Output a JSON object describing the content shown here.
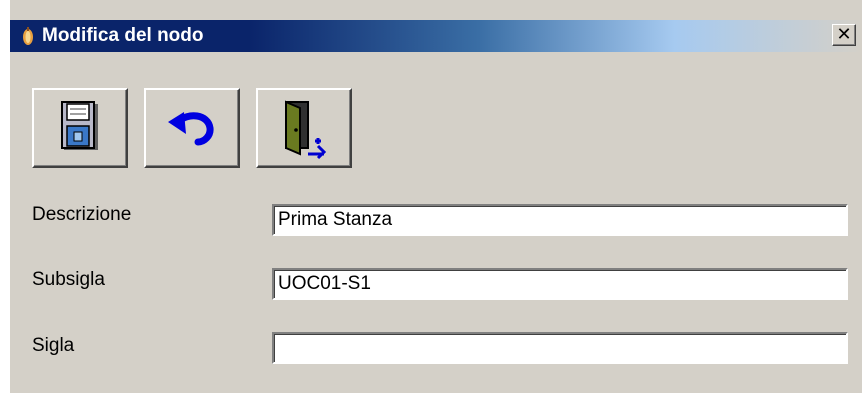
{
  "window": {
    "title": "Modifica del nodo",
    "close_label": "✕"
  },
  "toolbar": {
    "save_icon": "floppy-disk-save-icon",
    "undo_icon": "undo-arrow-icon",
    "exit_icon": "door-exit-icon"
  },
  "form": {
    "fields": [
      {
        "label": "Descrizione",
        "value": "Prima Stanza"
      },
      {
        "label": "Subsigla",
        "value": "UOC01-S1"
      },
      {
        "label": "Sigla",
        "value": ""
      }
    ]
  },
  "colors": {
    "titlebar_start": "#0a246a",
    "titlebar_end": "#a6caf0",
    "window_bg": "#d4d0c8"
  }
}
